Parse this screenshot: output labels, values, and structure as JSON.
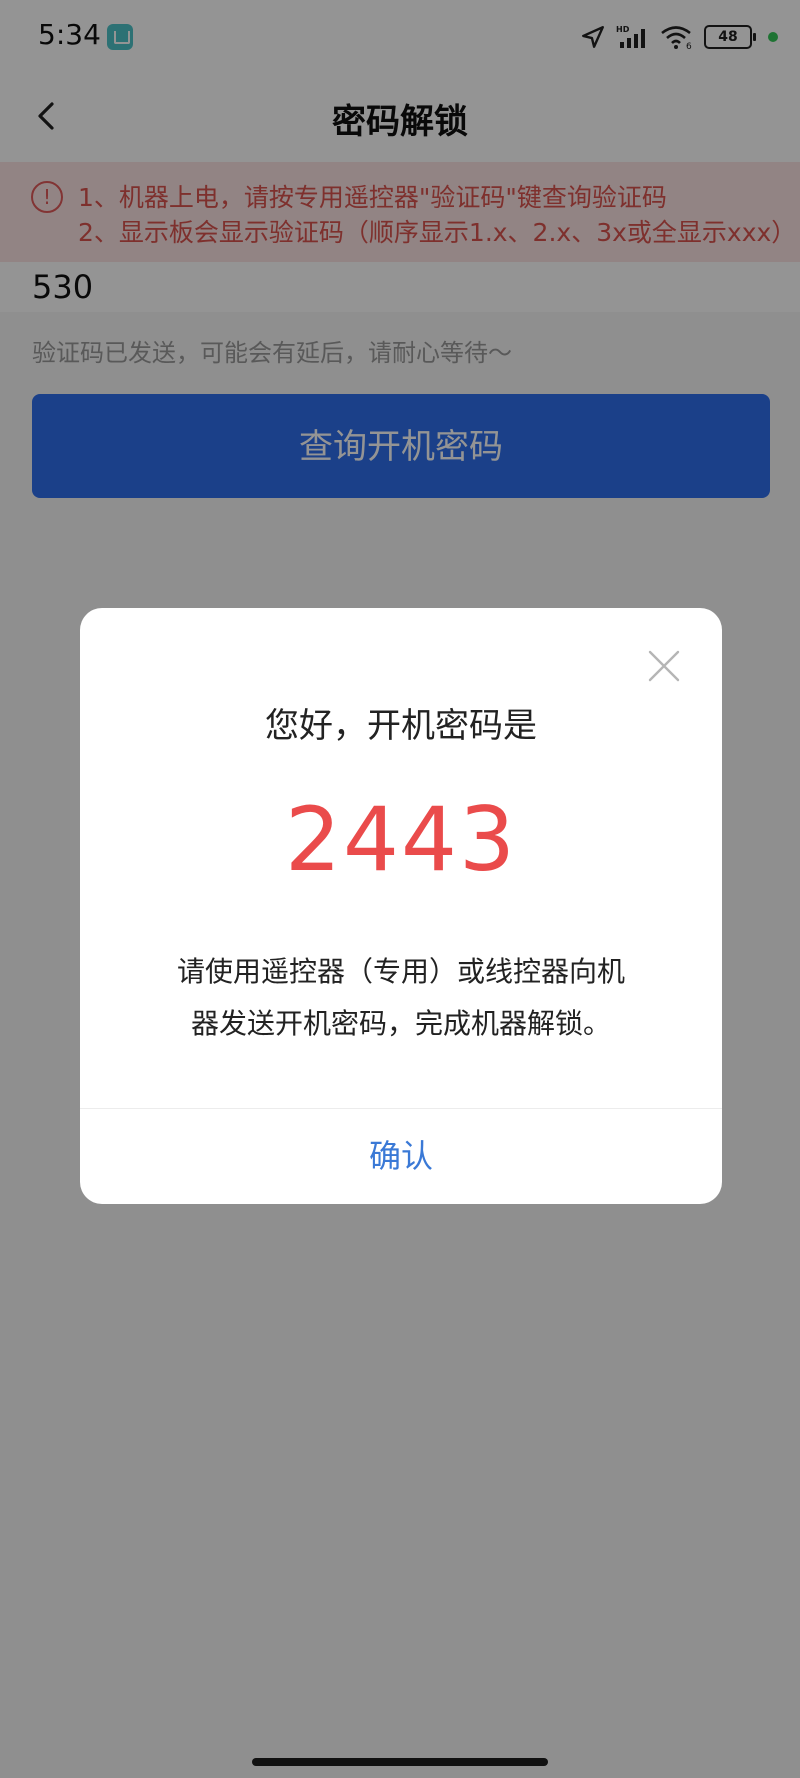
{
  "status_bar": {
    "time": "5:34",
    "battery": "48",
    "network": "HD",
    "icons": [
      "app-badge-icon",
      "location-arrow-icon",
      "signal-bars-icon",
      "wifi-icon",
      "battery-icon"
    ]
  },
  "header": {
    "title": "密码解锁",
    "back_icon": "chevron-left-icon"
  },
  "tip": {
    "icon": "exclamation-circle-icon",
    "line1": "1、机器上电，请按专用遥控器\"验证码\"键查询验证码",
    "line2": "2、显示板会显示验证码（顺序显示1.x、2.x、3x或全显示xxx）"
  },
  "form": {
    "code_value": "530",
    "hint": "验证码已发送，可能会有延后，请耐心等待～",
    "query_button": "查询开机密码"
  },
  "dialog": {
    "title": "您好，开机密码是",
    "password": "2443",
    "message_line1": "请使用遥控器（专用）或线控器向机",
    "message_line2": "器发送开机密码，完成机器解锁。",
    "confirm": "确认",
    "close_icon": "close-x-icon"
  },
  "colors": {
    "primary": "#2f6fec",
    "tip_text": "#d9534f",
    "tip_bg": "#fbe3e3",
    "password": "#ea4b4b",
    "confirm": "#3a79d6"
  }
}
